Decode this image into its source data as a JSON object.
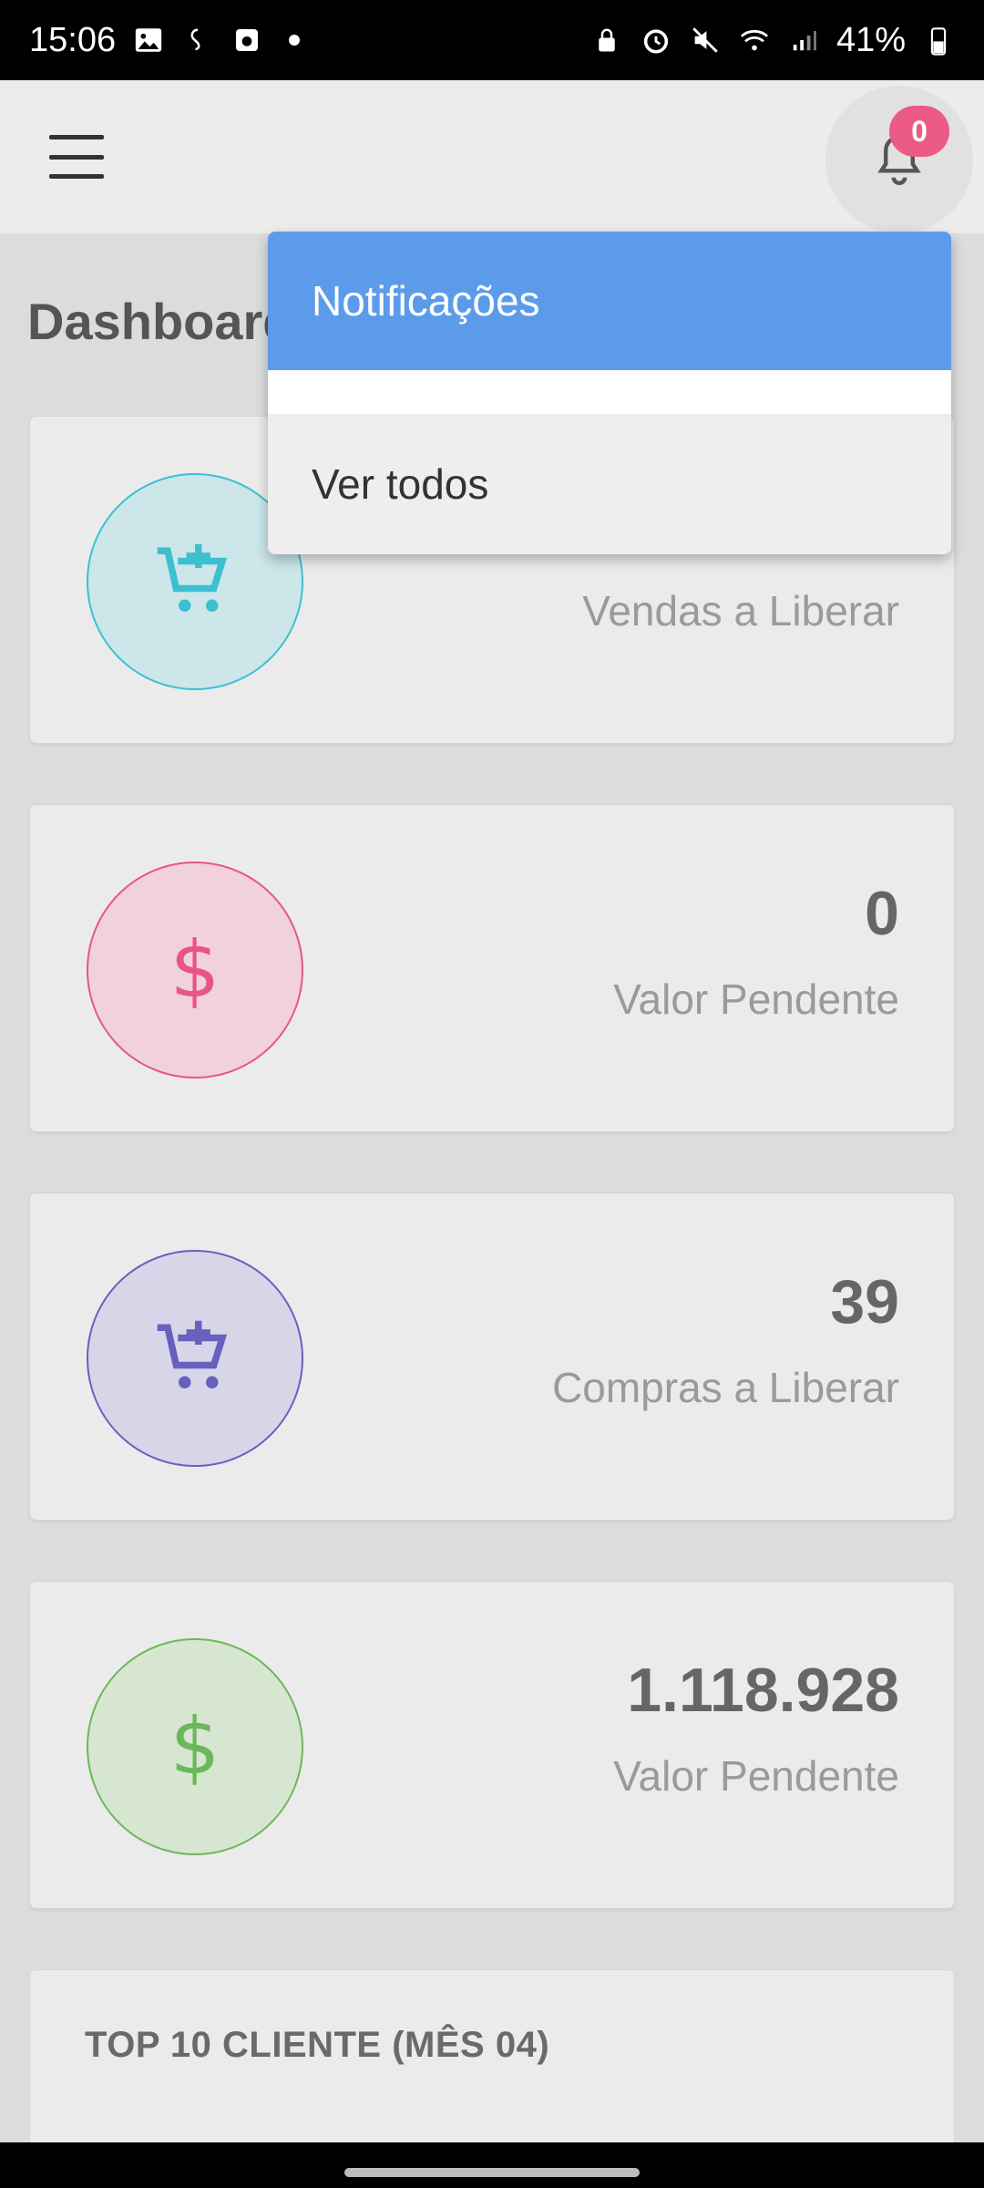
{
  "status_bar": {
    "time": "15:06",
    "battery": "41%",
    "left_icons": [
      "gallery-icon",
      "thread-icon",
      "calendar-icon",
      "dot-icon"
    ],
    "right_icons": [
      "lock-icon",
      "alarm-icon",
      "mute-icon",
      "wifi-icon",
      "signal-icon",
      "battery-icon"
    ]
  },
  "app_bar": {
    "notification_count": "0"
  },
  "page": {
    "title": "Dashboard"
  },
  "cards": [
    {
      "value": "",
      "label": "Vendas a Liberar",
      "icon": "cart-plus-icon",
      "color": "#3cc0d0",
      "bg": "#cce6ea"
    },
    {
      "value": "0",
      "label": "Valor Pendente",
      "icon": "dollar-icon",
      "color": "#e8548a",
      "bg": "#f0d1dc"
    },
    {
      "value": "39",
      "label": "Compras a Liberar",
      "icon": "cart-plus-icon",
      "color": "#6a5fbf",
      "bg": "#d6d6e8"
    },
    {
      "value": "1.118.928",
      "label": "Valor Pendente",
      "icon": "dollar-icon",
      "color": "#6bb85a",
      "bg": "#d6e6d1"
    }
  ],
  "top10": {
    "title": "TOP 10 CLIENTE (MÊS 04)"
  },
  "dropdown": {
    "header": "Notificações",
    "view_all": "Ver todos"
  }
}
